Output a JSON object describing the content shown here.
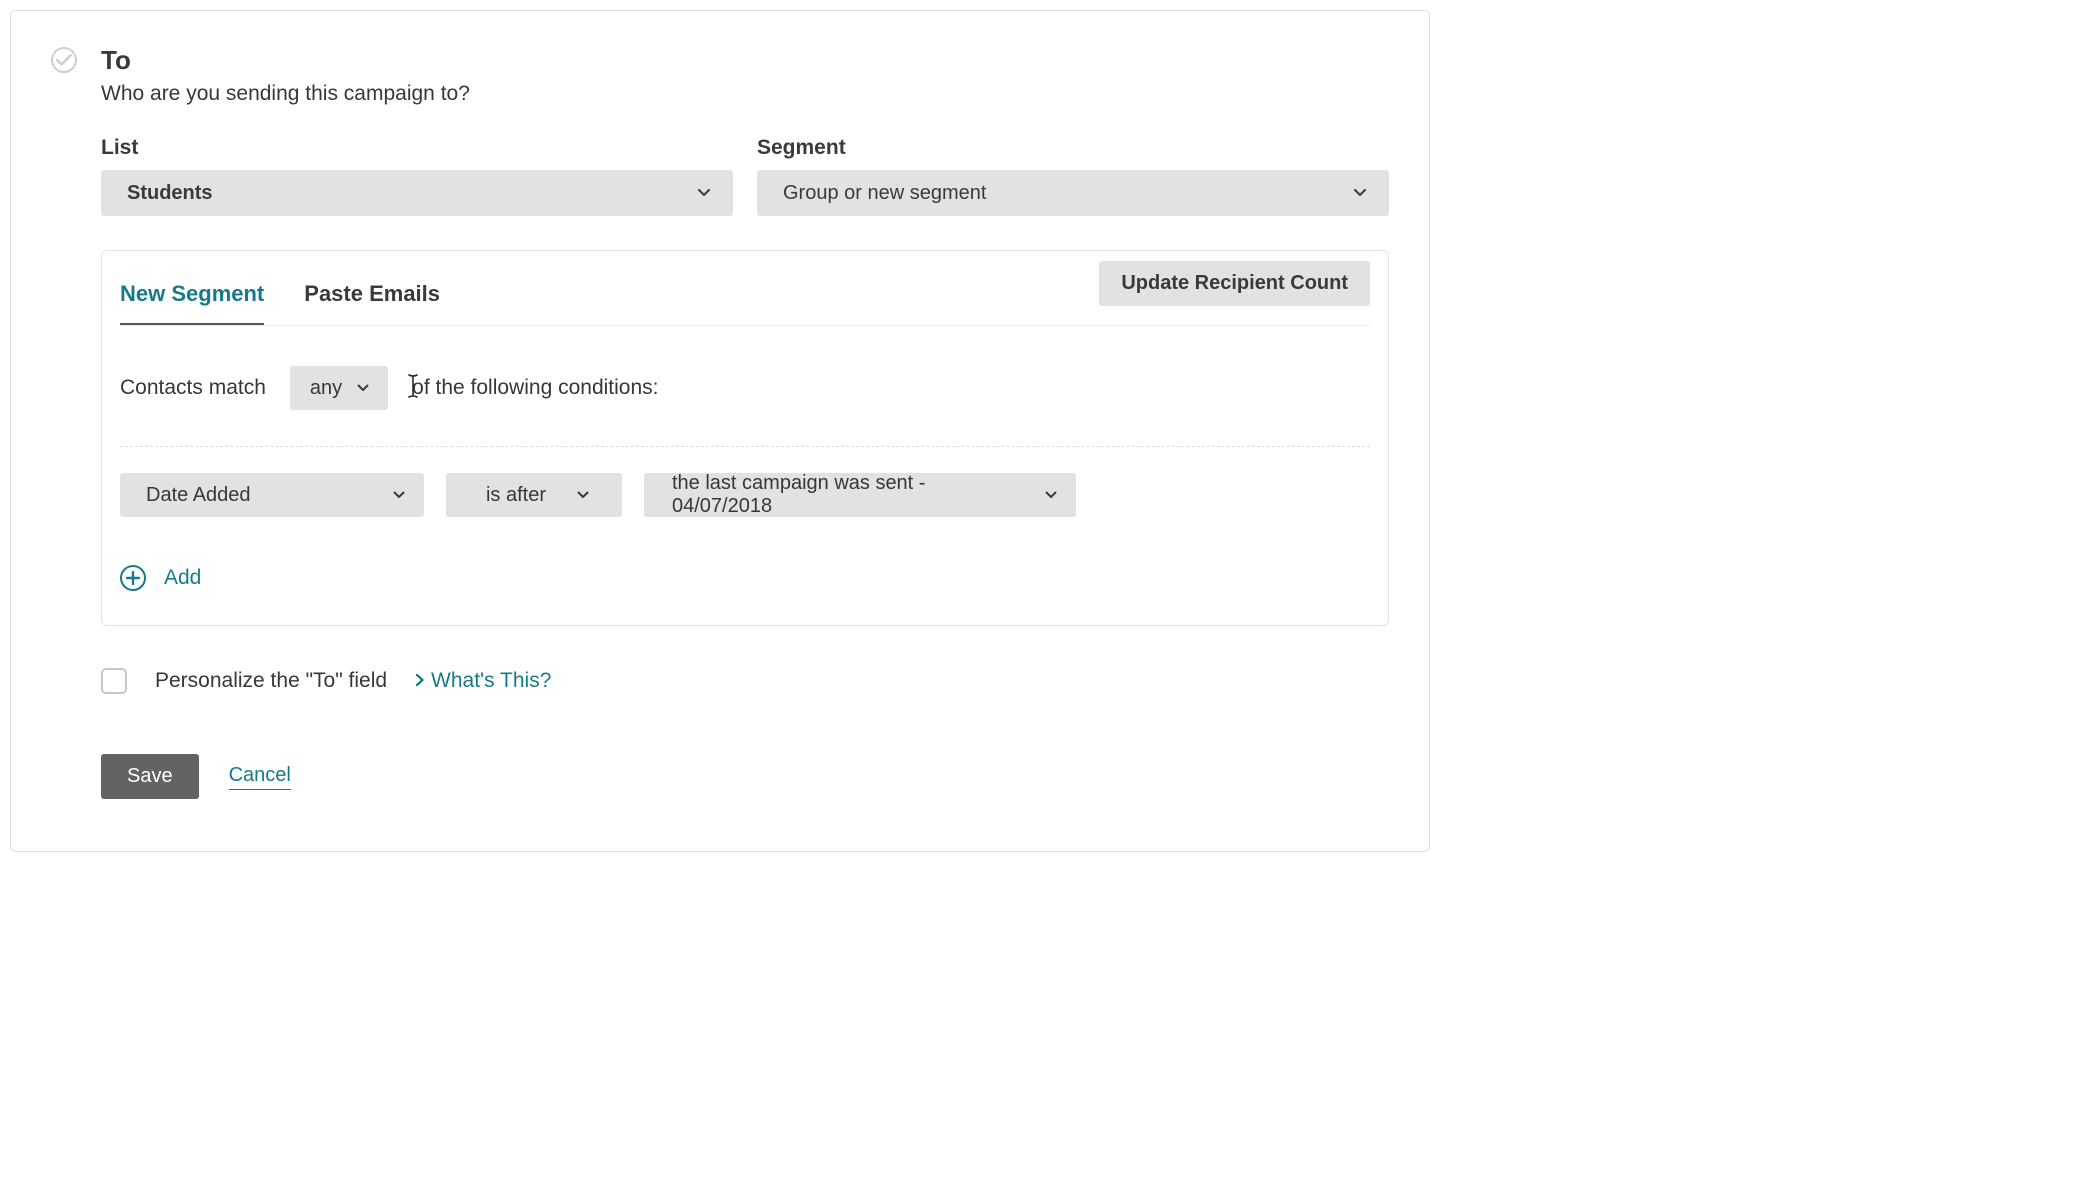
{
  "header": {
    "title": "To",
    "subtitle": "Who are you sending this campaign to?"
  },
  "fields": {
    "list_label": "List",
    "list_value": "Students",
    "segment_label": "Segment",
    "segment_value": "Group or new segment"
  },
  "segment_panel": {
    "update_label": "Update Recipient Count",
    "tabs": {
      "new_segment": "New Segment",
      "paste_emails": "Paste Emails"
    },
    "match_prefix": "Contacts match",
    "match_mode": "any",
    "match_suffix": "of the following conditions:",
    "condition": {
      "field": "Date Added",
      "op": "is after",
      "value": "the last campaign was sent - 04/07/2018"
    },
    "add_label": "Add"
  },
  "personalize": {
    "label": "Personalize the \"To\" field",
    "help_label": "What's This?"
  },
  "actions": {
    "save": "Save",
    "cancel": "Cancel"
  }
}
